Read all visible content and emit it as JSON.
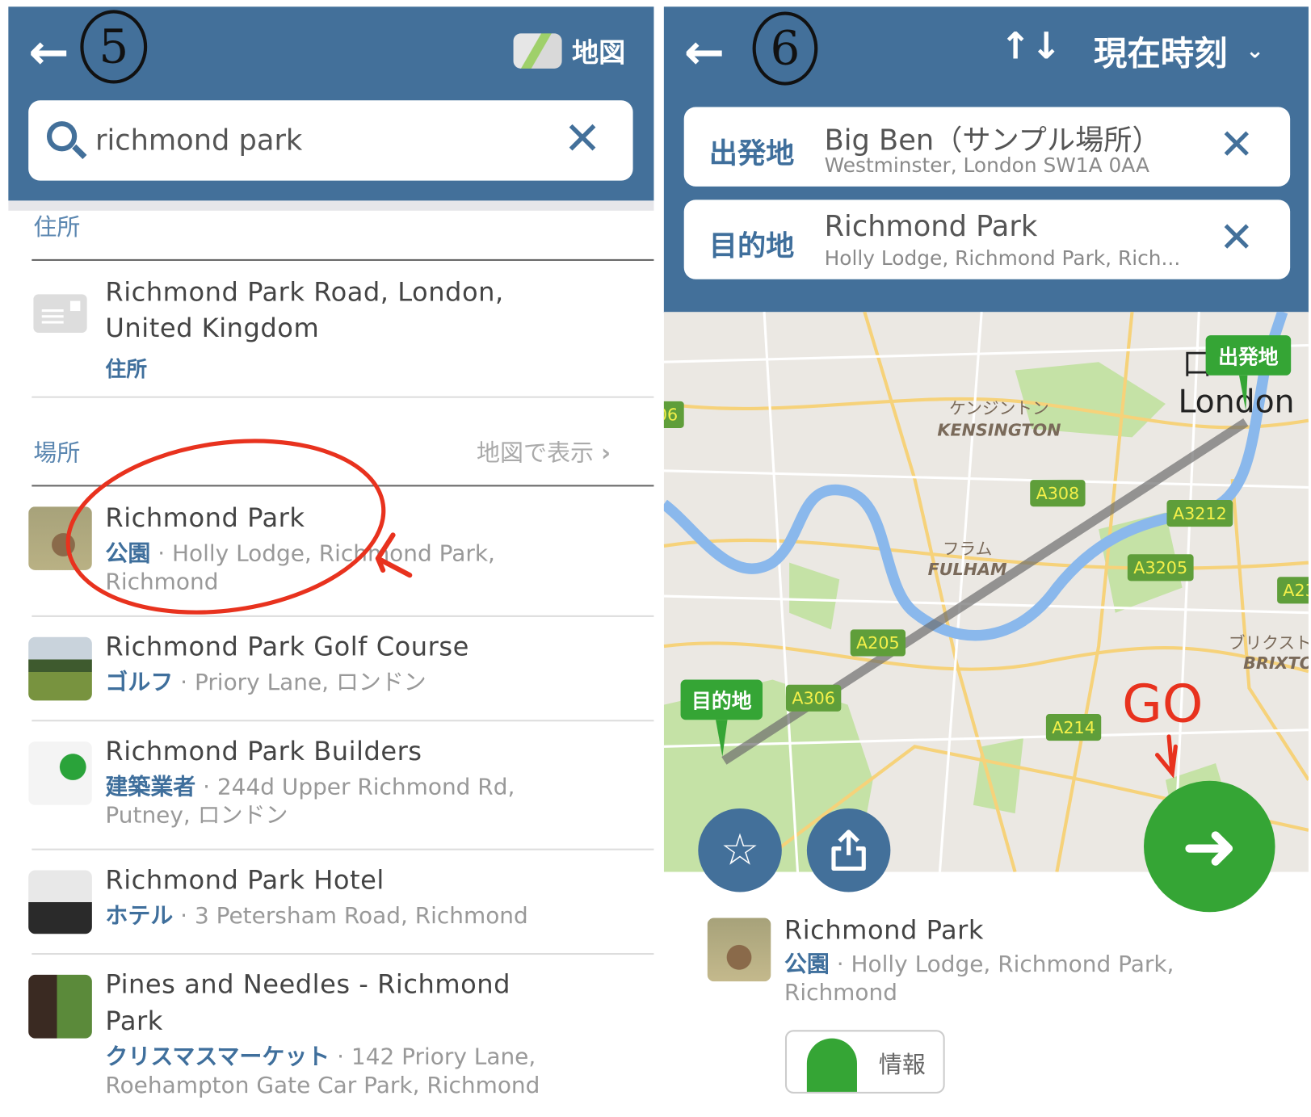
{
  "annotations": {
    "step_left": "5",
    "step_right": "6",
    "go": "GO"
  },
  "left": {
    "map_button": "地図",
    "search": {
      "value": "richmond park",
      "placeholder": ""
    },
    "address_section": {
      "label": "住所",
      "item": {
        "title_line1": "Richmond Park Road, London,",
        "title_line2": "United Kingdom",
        "category": "住所"
      }
    },
    "places_section": {
      "label": "場所",
      "show_on_map": "地図で表示"
    },
    "results": [
      {
        "title": "Richmond Park",
        "category": "公園",
        "address_line1": "Holly Lodge, Richmond Park,",
        "address_line2": "Richmond"
      },
      {
        "title": "Richmond Park Golf Course",
        "category": "ゴルフ",
        "address_line1": "Priory Lane, ロンドン",
        "address_line2": ""
      },
      {
        "title": "Richmond Park Builders",
        "category": "建築業者",
        "address_line1": "244d Upper Richmond Rd,",
        "address_line2": "Putney, ロンドン"
      },
      {
        "title": "Richmond Park Hotel",
        "category": "ホテル",
        "address_line1": "3 Petersham Road, Richmond",
        "address_line2": ""
      },
      {
        "title": "Pines and Needles - Richmond",
        "title_line2": "Park",
        "category": "クリスマスマーケット",
        "address_line1": "142 Priory Lane,",
        "address_line2": "Roehampton Gate Car Park, Richmond"
      }
    ],
    "separator": "·"
  },
  "right": {
    "time_selector": "現在時刻",
    "origin": {
      "label": "出発地",
      "name": "Big Ben（サンプル場所）",
      "address": "Westminster, London SW1A 0AA"
    },
    "destination": {
      "label": "目的地",
      "name": "Richmond Park",
      "address": "Holly Lodge, Richmond Park, Rich..."
    },
    "map": {
      "origin_marker": "出発地",
      "destination_marker": "目的地",
      "city_label": "London",
      "city_label_ja": "口",
      "areas": [
        {
          "ja": "ケンジントン",
          "en": "KENSINGTON"
        },
        {
          "ja": "フラム",
          "en": "FULHAM"
        },
        {
          "ja": "ブリクスト",
          "en": "BRIXTO"
        }
      ],
      "roads": [
        "A308",
        "A3212",
        "A3205",
        "A23",
        "A205",
        "A306",
        "A214",
        "06"
      ]
    },
    "result": {
      "title": "Richmond Park",
      "category": "公園",
      "address_line1": "Holly Lodge, Richmond Park,",
      "address_line2": "Richmond",
      "info_button": "情報"
    }
  },
  "colors": {
    "header": "#43709a",
    "accent_green": "#35a535",
    "annotation_red": "#e8321e",
    "category_blue": "#3f6f9c"
  }
}
